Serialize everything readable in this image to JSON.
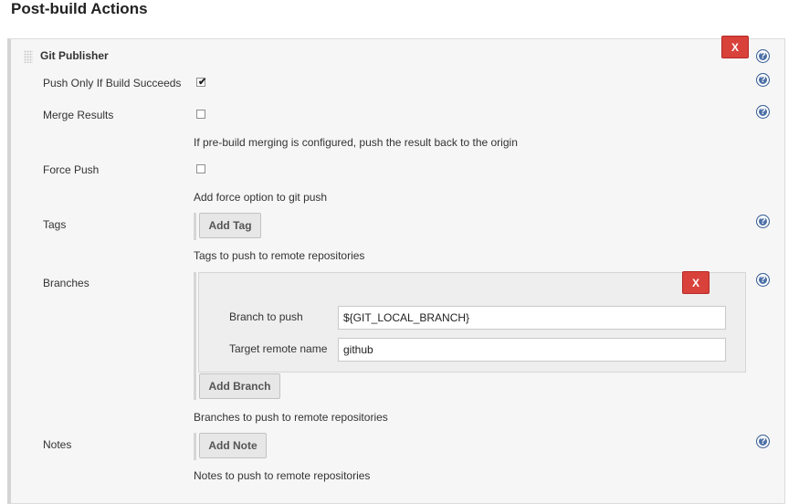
{
  "section_title": "Post-build Actions",
  "publisher": {
    "title": "Git Publisher",
    "delete_label": "X"
  },
  "fields": {
    "push_only": {
      "label": "Push Only If Build Succeeds",
      "checked": true
    },
    "merge_results": {
      "label": "Merge Results",
      "checked": false,
      "description": "If pre-build merging is configured, push the result back to the origin"
    },
    "force_push": {
      "label": "Force Push",
      "checked": false,
      "description": "Add force option to git push"
    },
    "tags": {
      "label": "Tags",
      "button": "Add Tag",
      "description": "Tags to push to remote repositories"
    },
    "branches": {
      "label": "Branches",
      "delete_label": "X",
      "branch_to_push_label": "Branch to push",
      "branch_to_push_value": "${GIT_LOCAL_BRANCH}",
      "target_remote_label": "Target remote name",
      "target_remote_value": "github",
      "button": "Add Branch",
      "description": "Branches to push to remote repositories"
    },
    "notes": {
      "label": "Notes",
      "button": "Add Note",
      "description": "Notes to push to remote repositories"
    }
  },
  "help_symbol": "?",
  "checkmark_symbol": "✔"
}
